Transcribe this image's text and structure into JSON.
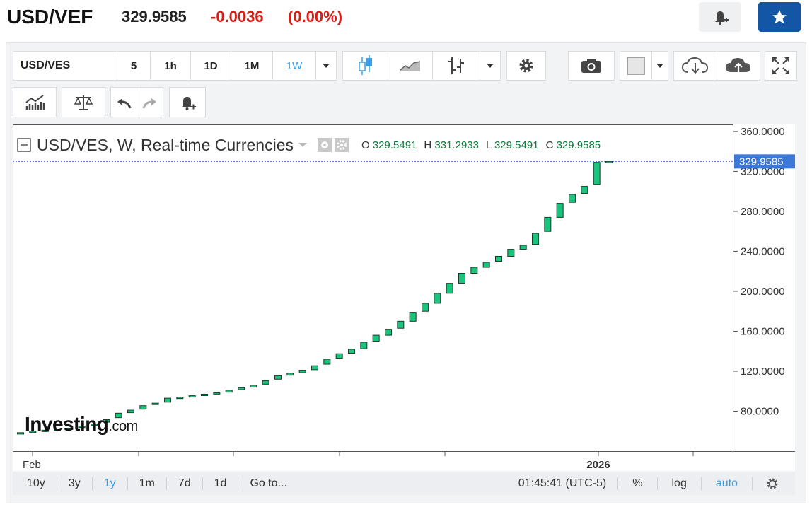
{
  "header": {
    "symbol": "USD/VEF",
    "price": "329.9585",
    "change": "-0.0036",
    "change_pct": "(0.00%)"
  },
  "toolbar": {
    "symbol_box": "USD/VES",
    "intervals": [
      "5",
      "1h",
      "1D",
      "1M",
      "1W"
    ],
    "selected_interval": "1W"
  },
  "chart": {
    "legend_title": "USD/VES, W, Real-time Currencies",
    "o_label": "O",
    "o": "329.5491",
    "h_label": "H",
    "h": "331.2933",
    "l_label": "L",
    "l": "329.5491",
    "c_label": "C",
    "c": "329.9585",
    "last_price_tag": "329.9585",
    "x_labels": [
      "Feb",
      "2026"
    ],
    "watermark_main": "Investing",
    "watermark_suffix": ".com"
  },
  "chart_data": {
    "type": "candlestick",
    "y_tick_labels": [
      "360.0000",
      "320.0000",
      "280.0000",
      "240.0000",
      "200.0000",
      "160.0000",
      "120.0000",
      "80.0000"
    ],
    "ylim": [
      40,
      367
    ],
    "last_value": 329.9585,
    "candles": [
      [
        57.5,
        58.5
      ],
      [
        59,
        60
      ],
      [
        60,
        61
      ],
      [
        61,
        62
      ],
      [
        62,
        63
      ],
      [
        64,
        65
      ],
      [
        66,
        67
      ],
      [
        69,
        71.5
      ],
      [
        73.5,
        78
      ],
      [
        78.5,
        81
      ],
      [
        82,
        85.5
      ],
      [
        87,
        88
      ],
      [
        89,
        93
      ],
      [
        93,
        94
      ],
      [
        94.5,
        95.5
      ],
      [
        96,
        97
      ],
      [
        97.5,
        98.5
      ],
      [
        99,
        101
      ],
      [
        101.5,
        103.5
      ],
      [
        104,
        106
      ],
      [
        107,
        110.5
      ],
      [
        112,
        115.5
      ],
      [
        116,
        118
      ],
      [
        118.5,
        121
      ],
      [
        121.5,
        125.5
      ],
      [
        127,
        132
      ],
      [
        133,
        137.5
      ],
      [
        138,
        142
      ],
      [
        142.5,
        149
      ],
      [
        150,
        156
      ],
      [
        156,
        162
      ],
      [
        163,
        170
      ],
      [
        170,
        179
      ],
      [
        180,
        188
      ],
      [
        188,
        198
      ],
      [
        198,
        208
      ],
      [
        208,
        218
      ],
      [
        218,
        224
      ],
      [
        224,
        229
      ],
      [
        230,
        235
      ],
      [
        235,
        242
      ],
      [
        242,
        246
      ],
      [
        247,
        258
      ],
      [
        260,
        274
      ],
      [
        274,
        288
      ],
      [
        289,
        297
      ],
      [
        298,
        305
      ],
      [
        307,
        329
      ],
      [
        329.5491,
        329.9585
      ]
    ]
  },
  "bottom": {
    "ranges": [
      "10y",
      "3y",
      "1y",
      "1m",
      "7d",
      "1d"
    ],
    "selected_range": "1y",
    "goto": "Go to...",
    "time": "01:45:41 (UTC-5)",
    "pct": "%",
    "log": "log",
    "auto": "auto"
  },
  "colors": {
    "up": "#1bc47d",
    "down": "#d91e18",
    "accent": "#3aa0e6",
    "star_bg": "#1256a5",
    "price_tag": "#3c78d8"
  }
}
